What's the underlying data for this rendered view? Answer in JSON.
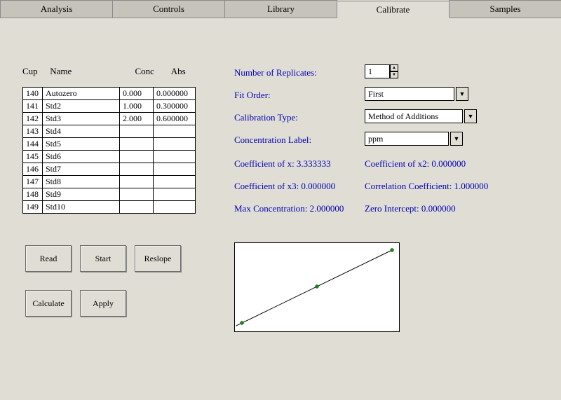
{
  "tabs": {
    "analysis": "Analysis",
    "controls": "Controls",
    "library": "Library",
    "calibrate": "Calibrate",
    "samples": "Samples"
  },
  "columns": {
    "cup": "Cup",
    "name": "Name",
    "conc": "Conc",
    "abs": "Abs"
  },
  "rows": [
    {
      "cup": "140",
      "name": "Autozero",
      "conc": "0.000",
      "abs": "0.000000"
    },
    {
      "cup": "141",
      "name": "Std2",
      "conc": "1.000",
      "abs": "0.300000"
    },
    {
      "cup": "142",
      "name": "Std3",
      "conc": "2.000",
      "abs": "0.600000"
    },
    {
      "cup": "143",
      "name": "Std4",
      "conc": "",
      "abs": ""
    },
    {
      "cup": "144",
      "name": "Std5",
      "conc": "",
      "abs": ""
    },
    {
      "cup": "145",
      "name": "Std6",
      "conc": "",
      "abs": ""
    },
    {
      "cup": "146",
      "name": "Std7",
      "conc": "",
      "abs": ""
    },
    {
      "cup": "147",
      "name": "Std8",
      "conc": "",
      "abs": ""
    },
    {
      "cup": "148",
      "name": "Std9",
      "conc": "",
      "abs": ""
    },
    {
      "cup": "149",
      "name": "Std10",
      "conc": "",
      "abs": ""
    }
  ],
  "buttons": {
    "read": "Read",
    "start": "Start",
    "reslope": "Reslope",
    "calculate": "Calculate",
    "apply": "Apply"
  },
  "params": {
    "replicates_label": "Number of Replicates:",
    "replicates_value": "1",
    "fit_order_label": "Fit Order:",
    "fit_order_value": "First",
    "cal_type_label": "Calibration Type:",
    "cal_type_value": "Method of Additions",
    "conc_label_label": "Concentration Label:",
    "conc_label_value": "ppm",
    "coef_x": "Coefficient of x: 3.333333",
    "coef_x2": "Coefficient of x2: 0.000000",
    "coef_x3": "Coefficient of x3: 0.000000",
    "corr": "Correlation Coefficient: 1.000000",
    "max_conc": "Max Concentration: 2.000000",
    "zero_int": "Zero Intercept: 0.000000"
  },
  "chart_data": {
    "type": "line",
    "x": [
      0.0,
      1.0,
      2.0
    ],
    "y": [
      0.0,
      0.3,
      0.6
    ],
    "xlabel": "",
    "ylabel": "",
    "xlim": [
      0,
      2
    ],
    "ylim": [
      0,
      0.6
    ]
  }
}
